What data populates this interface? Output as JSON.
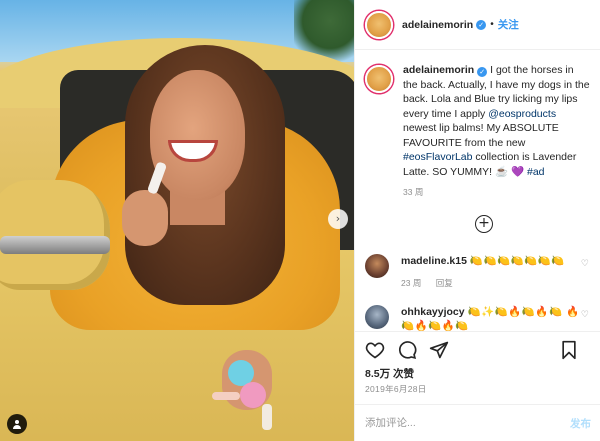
{
  "post": {
    "photo_alt": "woman leaning out of a yellow car window holding lip balm",
    "next_icon": "chevron-right-icon",
    "tag_icon": "person-tag-icon"
  },
  "header": {
    "username": "adelainemorin",
    "verified_icon": "verified-badge-icon",
    "separator": "•",
    "follow_label": "关注"
  },
  "caption": {
    "username": "adelainemorin",
    "text_part1": "I got the horses in the back. Actually, I have my dogs in the back. Lola and Blue try licking my lips every time I apply ",
    "mention": "@eosproducts",
    "text_part2": " newest lip balms! My ABSOLUTE FAVOURITE from the new ",
    "hashtag1": "#eosFlavorLab",
    "text_part3": " collection is Lavender Latte. SO YUMMY! ☕ 💜 ",
    "hashtag2": "#ad",
    "time": "33 周"
  },
  "load_more_icon": "plus-circle-icon",
  "comments": [
    {
      "username": "madeline.k15",
      "text": "🍋🍋🍋🍋🍋🍋🍋",
      "time": "23 周",
      "reply_label": "回复",
      "like_icon": "heart-outline-icon"
    },
    {
      "username": "ohhkayyjocy",
      "text": "🍋✨🍋🔥🍋🔥🍋 🔥🍋🔥🍋🔥🍋",
      "like_icon": "heart-outline-icon"
    }
  ],
  "actions": {
    "like_icon": "heart-outline-icon",
    "comment_icon": "comment-bubble-icon",
    "share_icon": "paper-plane-icon",
    "save_icon": "bookmark-icon"
  },
  "likes": "8.5万 次赞",
  "date": "2019年6月28日",
  "add_comment": {
    "placeholder": "添加评论...",
    "post_label": "发布"
  },
  "colors": {
    "link_blue": "#3897f0",
    "hashtag_navy": "#003569",
    "muted_gray": "#8e8e8e",
    "post_disabled": "#b2dffc"
  }
}
